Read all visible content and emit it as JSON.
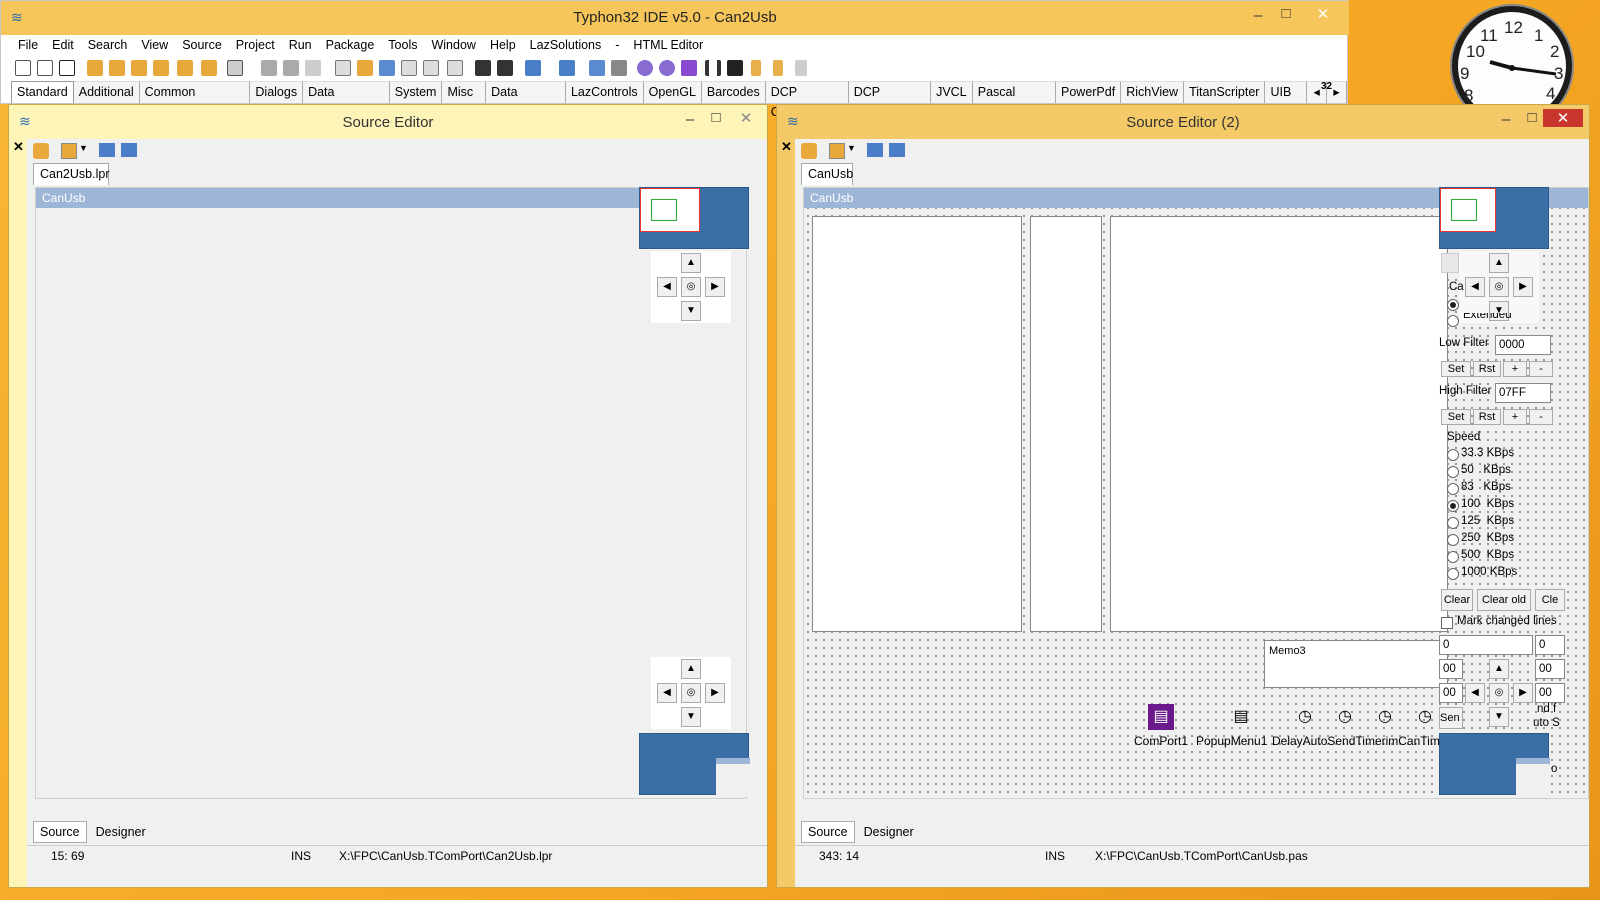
{
  "main_window": {
    "title": "Typhon32 IDE v5.0 - Can2Usb",
    "minimize": "–",
    "maximize": "□",
    "close": "✕",
    "menu": [
      "File",
      "Edit",
      "Search",
      "View",
      "Source",
      "Project",
      "Run",
      "Package",
      "Tools",
      "Window",
      "Help",
      "LazSolutions",
      "-",
      "HTML Editor"
    ],
    "palette_tabs": [
      "Standard",
      "Additional",
      "Common Controls",
      "Dialogs",
      "Data Controls",
      "System",
      "Misc",
      "Data Access",
      "LazControls",
      "OpenGL",
      "Barcodes",
      "DCP Ciphers",
      "DCP Hashes",
      "JVCL",
      "Pascal Script",
      "PowerPdf",
      "RichView",
      "TitanScripter",
      "UIB"
    ],
    "palette_scroll_left": "◂",
    "palette_scroll_right": "▸",
    "palette_badge": "32"
  },
  "clock": {
    "numerals": [
      "12",
      "1",
      "2",
      "3",
      "4",
      "8",
      "9",
      "10",
      "11"
    ]
  },
  "editor1": {
    "title": "Source Editor",
    "close_x": "✕",
    "file_tab": "Can2Usb.lpr",
    "form_caption": "CanUsb",
    "bottom_tabs": [
      "Source",
      "Designer"
    ],
    "status_pos": "15: 69",
    "status_mode": "INS",
    "status_path": "X:\\FPC\\CanUsb.TComPort\\Can2Usb.lpr"
  },
  "editor2": {
    "title": "Source Editor (2)",
    "close_x": "✕",
    "file_tab": "CanUsb",
    "form_caption": "CanUsb",
    "bottom_tabs": [
      "Source",
      "Designer"
    ],
    "status_pos": "343: 14",
    "status_mode": "INS",
    "status_path": "X:\\FPC\\CanUsb.TComPort\\CanUsb.pas",
    "right_panel": {
      "ca_label": "Ca",
      "extended_label": "Extended",
      "low_filter_label": "Low Filter",
      "low_filter_value": "0000",
      "high_filter_label": "High Filter",
      "high_filter_value": "07FF",
      "set": "Set",
      "rst": "Rst",
      "plus": "+",
      "minus": "-",
      "speed_label": "Speed",
      "speeds": [
        "33.3 KBps",
        "50   KBps",
        "83   KBps",
        "100  KBps",
        "125  KBps",
        "250  KBps",
        "500  KBps",
        "1000 KBps"
      ],
      "selected_speed": "100  KBps",
      "clear": "Clear",
      "clear_old": "Clear old",
      "clear_cut": "Cle",
      "mark_changed": "Mark changed lines",
      "field_a": "0",
      "field_b": "0",
      "hex1": "00",
      "hex1b": "00",
      "hex2": "00",
      "hex2b": "00",
      "send_cut": "Sen",
      "send_cut2": "nd f",
      "auto_cut": "uto S",
      "o_cut": "o"
    },
    "memo3": "Memo3",
    "components": [
      "ComPort1",
      "PopupMenu1",
      "DelayAutoSendTimerimCanTimer"
    ]
  },
  "nav": {
    "up": "▲",
    "down": "▼",
    "left": "◀",
    "right": "▶",
    "center": "◎"
  }
}
